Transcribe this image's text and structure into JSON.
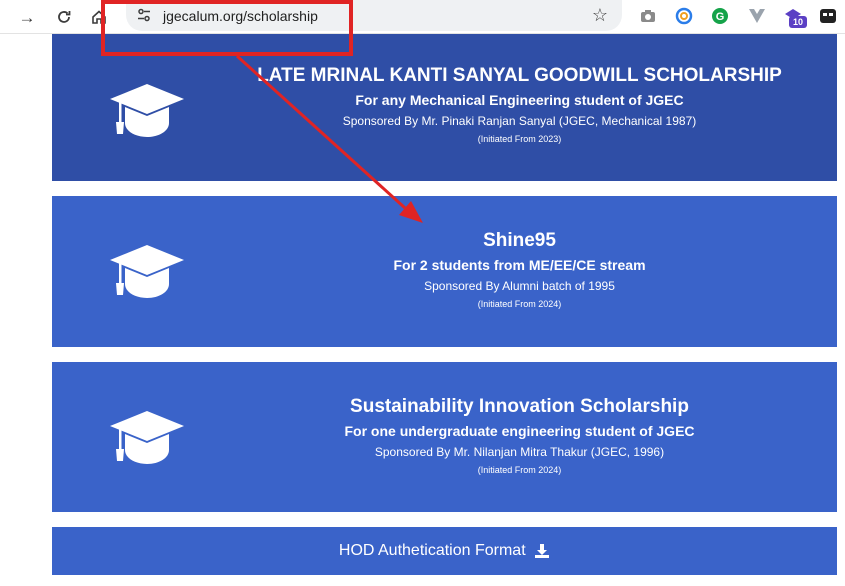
{
  "browser": {
    "url": "jgecalum.org/scholarship",
    "extension_badge": "10"
  },
  "scholarships": [
    {
      "title": "LATE MRINAL KANTI SANYAL GOODWILL SCHOLARSHIP",
      "subtitle": "For any Mechanical Engineering student of JGEC",
      "sponsor": "Sponsored By Mr. Pinaki Ranjan Sanyal (JGEC, Mechanical 1987)",
      "initiated": "(Initiated From 2023)"
    },
    {
      "title": "Shine95",
      "subtitle": "For 2 students from ME/EE/CE stream",
      "sponsor": "Sponsored By Alumni batch of 1995",
      "initiated": "(Initiated From 2024)"
    },
    {
      "title": "Sustainability Innovation Scholarship",
      "subtitle": "For one undergraduate engineering student of JGEC",
      "sponsor": "Sponsored By Mr. Nilanjan Mitra Thakur (JGEC, 1996)",
      "initiated": "(Initiated From 2024)"
    }
  ],
  "hod_link": {
    "label": "HOD Authetication Format"
  },
  "icons": {
    "card": "graduation-cap-icon",
    "download": "download-icon"
  },
  "colors": {
    "card_blue": "#3a63c9",
    "card_dark_blue": "#2f4ea6",
    "annotation_red": "#e02424"
  }
}
